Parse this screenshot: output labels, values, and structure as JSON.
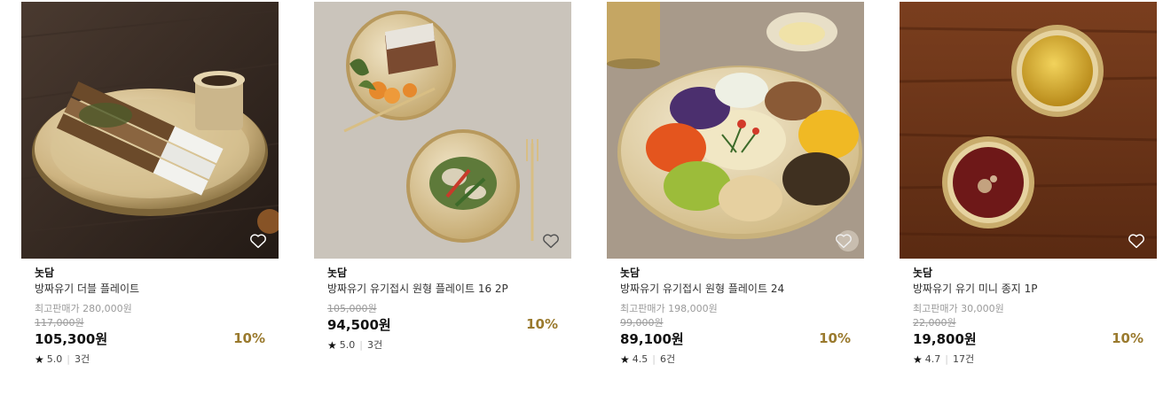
{
  "products": [
    {
      "brand": "놋담",
      "name": "방짜유기 더블 플레이트",
      "max_price": "최고판매가 280,000원",
      "original_price": "117,000원",
      "price": "105,300원",
      "discount": "10%",
      "star": "★",
      "rating": "5.0",
      "reviews": "3건",
      "image": "brass-double-plate-with-rice-cakes",
      "wishlist_icon": "heart-outline-icon"
    },
    {
      "brand": "놋담",
      "name": "방짜유기 유기접시 원형 플레이트 16 2P",
      "original_price": "105,000원",
      "price": "94,500원",
      "discount": "10%",
      "star": "★",
      "rating": "5.0",
      "reviews": "3건",
      "image": "two-round-brass-plates-cake-and-salad",
      "wishlist_icon": "heart-outline-icon"
    },
    {
      "brand": "놋담",
      "name": "방짜유기 유기접시 원형 플레이트 24",
      "max_price": "최고판매가 198,000원",
      "original_price": "99,000원",
      "price": "89,100원",
      "discount": "10%",
      "star": "★",
      "rating": "4.5",
      "reviews": "6건",
      "image": "brass-plate-with-colorful-vegetables",
      "wishlist_icon": "heart-outline-icon"
    },
    {
      "brand": "놋담",
      "name": "방짜유기 유기 미니 종지 1P",
      "max_price": "최고판매가 30,000원",
      "original_price": "22,000원",
      "price": "19,800원",
      "discount": "10%",
      "star": "★",
      "rating": "4.7",
      "reviews": "17건",
      "image": "brass-mini-bowls-with-sauces",
      "wishlist_icon": "heart-outline-icon"
    }
  ],
  "colors": {
    "discount": "#9a7a2e",
    "muted": "#9a9a9a"
  }
}
